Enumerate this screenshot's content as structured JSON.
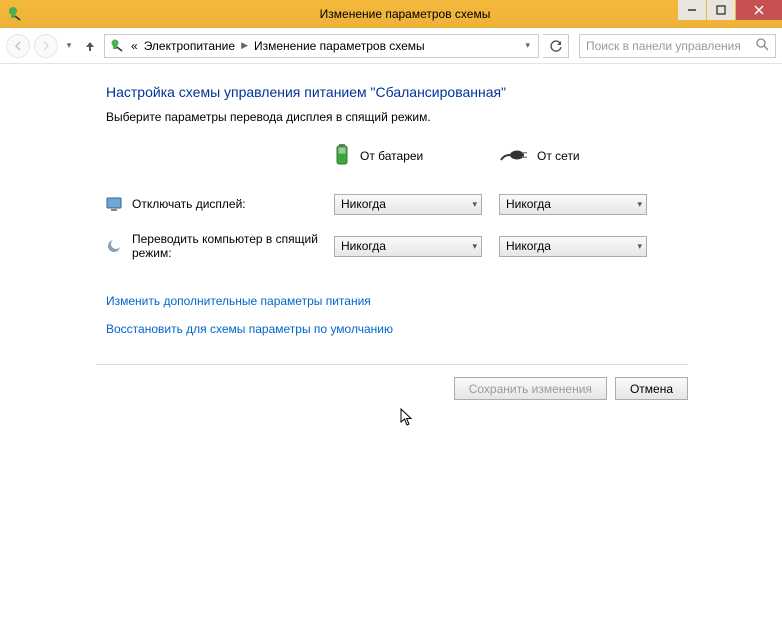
{
  "window": {
    "title": "Изменение параметров схемы"
  },
  "breadcrumbs": {
    "prefix": "«",
    "items": [
      "Электропитание",
      "Изменение параметров схемы"
    ]
  },
  "search": {
    "placeholder": "Поиск в панели управления"
  },
  "page": {
    "heading": "Настройка схемы управления питанием \"Сбалансированная\"",
    "subtext": "Выберите параметры перевода дисплея в спящий режим.",
    "col_battery": "От батареи",
    "col_mains": "От сети",
    "rows": {
      "display_off": {
        "label": "Отключать дисплей:",
        "battery": "Никогда",
        "mains": "Никогда"
      },
      "sleep": {
        "label": "Переводить компьютер в спящий режим:",
        "battery": "Никогда",
        "mains": "Никогда"
      }
    },
    "link_advanced": "Изменить дополнительные параметры питания",
    "link_restore": "Восстановить для схемы параметры по умолчанию",
    "save_btn": "Сохранить изменения",
    "cancel_btn": "Отмена"
  }
}
